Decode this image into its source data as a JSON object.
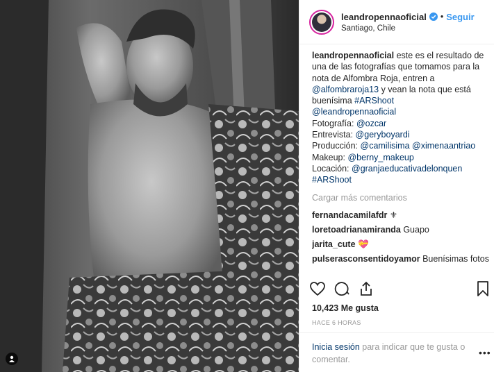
{
  "header": {
    "username": "leandropennaoficial",
    "verified_icon": "verified-badge-icon",
    "separator": "•",
    "follow_label": "Seguir",
    "location": "Santiago, Chile"
  },
  "caption": {
    "author": "leandropennaoficial",
    "text1": "este es el resultado de una de las fotografías que tomamos para la nota de Alfombra Roja, entren a",
    "mention1": "@alfombraroja13",
    "text2": "y vean la nota que está buenísima",
    "hashtag1": "#ARShoot",
    "mention2": "@leandropennaoficial",
    "foto_label": "Fotografía:",
    "foto_mention": "@ozcar",
    "entrevista_label": "Entrevista:",
    "entrevista_mention": "@geryboyardi",
    "produccion_label": "Producción:",
    "produccion_mention1": "@camilisima",
    "produccion_mention2": "@ximenaantriao",
    "makeup_label": "Makeup:",
    "makeup_mention": "@berny_makeup",
    "locacion_label": "Locación:",
    "locacion_mention": "@granjaeducativadelonquen",
    "hashtag2": "#ARShoot"
  },
  "load_more": "Cargar más comentarios",
  "comments": [
    {
      "author": "fernandacamilafdr",
      "text": "⚜"
    },
    {
      "author": "loretoadrianamiranda",
      "text": "Guapo"
    },
    {
      "author": "jarita_cute",
      "text": "💝"
    },
    {
      "author": "pulserasconsentidoyamor",
      "text": "Buenísimas fotos"
    }
  ],
  "actions": {
    "like_icon": "heart-icon",
    "comment_icon": "comment-icon",
    "share_icon": "share-icon",
    "save_icon": "bookmark-icon"
  },
  "likes": "10,423 Me gusta",
  "time": "HACE 6 HORAS",
  "login": {
    "link": "Inicia sesión",
    "text": "para indicar que te gusta o comentar."
  },
  "more_options": "•••"
}
